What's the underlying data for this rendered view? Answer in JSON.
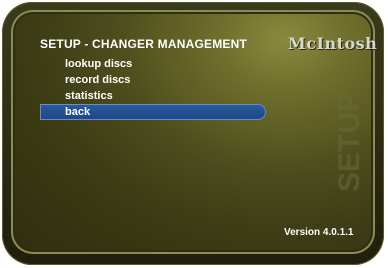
{
  "header": {
    "title": "SETUP - CHANGER MANAGEMENT",
    "logo_text": "McIntosh"
  },
  "menu": {
    "items": [
      {
        "label": "lookup discs",
        "selected": false
      },
      {
        "label": "record discs",
        "selected": false
      },
      {
        "label": "statistics",
        "selected": false
      },
      {
        "label": "back",
        "selected": true
      }
    ]
  },
  "watermark_text": "SETUP",
  "footer": {
    "version": "Version 4.0.1.1"
  },
  "colors": {
    "selection": "#1c4788",
    "panel": "#4b4b1c",
    "text": "#ffffff"
  }
}
